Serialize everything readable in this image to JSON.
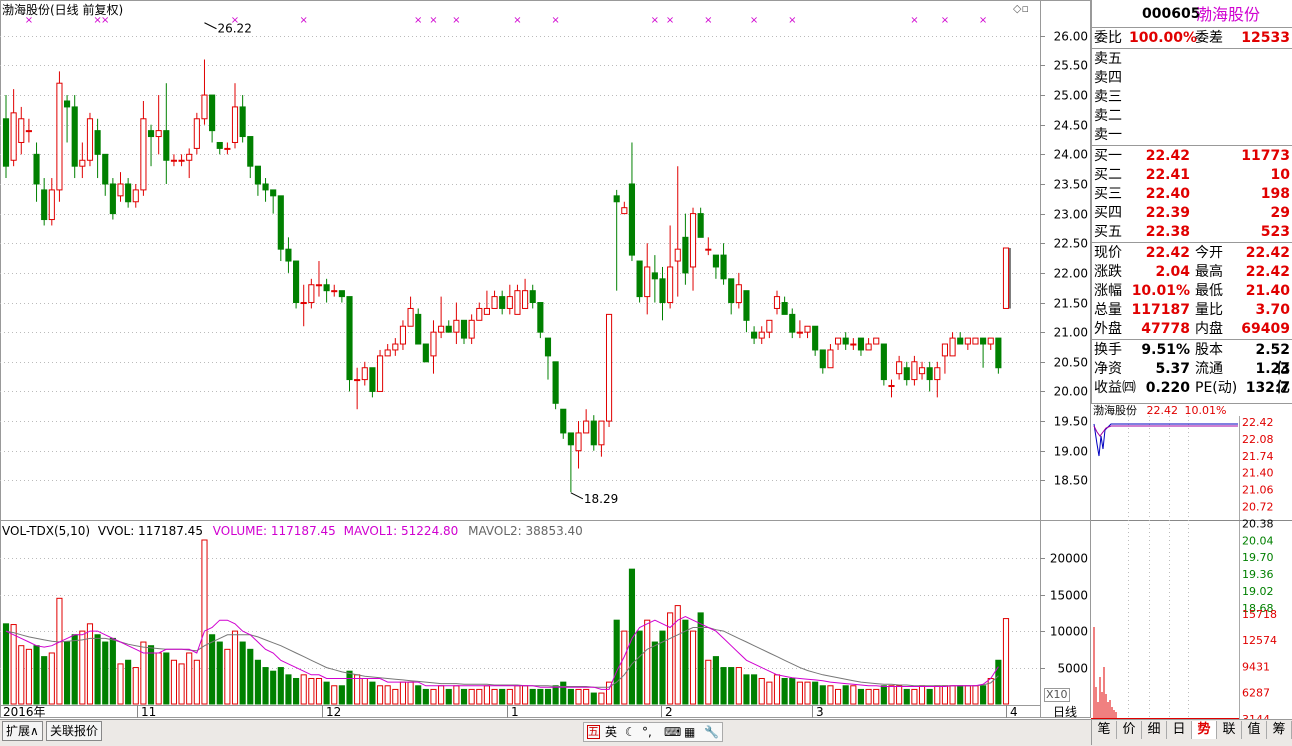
{
  "header": {
    "title": "渤海股份(日线 前复权)",
    "vol_label": "VOL-TDX(5,10)",
    "vvol": "VVOL: 117187.45",
    "volume": "VOLUME: 117187.45",
    "mavol1": "MAVOL1: 51224.80",
    "mavol2": "MAVOL2: 38853.40",
    "high_mark": "26.22",
    "low_mark": "18.29",
    "x_axis": [
      "2016年",
      "11",
      "12",
      "1",
      "2",
      "3",
      "4"
    ]
  },
  "quote": {
    "code": "000605",
    "name": "渤海股份",
    "weibi_label": "委比",
    "weibi": "100.00%",
    "weicha_label": "委差",
    "weicha": "12533",
    "sell": [
      {
        "label": "卖五"
      },
      {
        "label": "卖四"
      },
      {
        "label": "卖三"
      },
      {
        "label": "卖二"
      },
      {
        "label": "卖一"
      }
    ],
    "buy": [
      {
        "label": "买一",
        "price": "22.42",
        "vol": "11773"
      },
      {
        "label": "买二",
        "price": "22.41",
        "vol": "10"
      },
      {
        "label": "买三",
        "price": "22.40",
        "vol": "198"
      },
      {
        "label": "买四",
        "price": "22.39",
        "vol": "29"
      },
      {
        "label": "买五",
        "price": "22.38",
        "vol": "523"
      }
    ],
    "stats": [
      {
        "l1": "现价",
        "v1": "22.42",
        "l2": "今开",
        "v2": "22.42"
      },
      {
        "l1": "涨跌",
        "v1": "2.04",
        "l2": "最高",
        "v2": "22.42"
      },
      {
        "l1": "涨幅",
        "v1": "10.01%",
        "l2": "最低",
        "v2": "21.40"
      },
      {
        "l1": "总量",
        "v1": "117187",
        "l2": "量比",
        "v2": "3.70"
      },
      {
        "l1": "外盘",
        "v1": "47778",
        "l2": "内盘",
        "v2": "69409"
      }
    ],
    "fund": [
      {
        "l1": "换手",
        "v1": "9.51%",
        "l2": "股本",
        "v2": "2.52亿"
      },
      {
        "l1": "净资",
        "v1": "5.37",
        "l2": "流通",
        "v2": "1.23亿"
      },
      {
        "l1": "收益㈣",
        "v1": "0.220",
        "l2": "PE(动)",
        "v2": "132.7"
      }
    ]
  },
  "mini": {
    "name": "渤海股份",
    "price": "22.42",
    "pct": "10.01%",
    "price_ticks": [
      "22.42",
      "22.08",
      "21.74",
      "21.40",
      "21.06",
      "20.72",
      "20.38",
      "20.04",
      "19.70",
      "19.36",
      "19.02",
      "18.68"
    ],
    "vol_ticks": [
      "15718",
      "12574",
      "9431",
      "6287",
      "3144"
    ]
  },
  "bottom": {
    "tabs": [
      "扩展∧",
      "关联报价"
    ],
    "ime": [
      "五",
      "英"
    ],
    "period_label": "日线",
    "x10": "X10",
    "right_tabs": [
      "笔",
      "价",
      "细",
      "日",
      "势",
      "联",
      "值",
      "筹"
    ]
  },
  "colors": {
    "up": "#e00000",
    "down": "#008000",
    "ma1": "#d000d0",
    "ma2": "#777777",
    "mark": "#d000d0"
  },
  "chart_data": {
    "type": "candlestick",
    "title": "渤海股份(日线 前复权)",
    "ylim": [
      18.0,
      26.3
    ],
    "y_ticks": [
      18.5,
      19.0,
      19.5,
      20.0,
      20.5,
      21.0,
      21.5,
      22.0,
      22.5,
      23.0,
      23.5,
      24.0,
      24.5,
      25.0,
      25.5,
      26.0
    ],
    "vol_ticks": [
      5000,
      10000,
      15000,
      20000
    ],
    "vol_unit_label": "X10",
    "candles": [
      [
        24.6,
        23.8,
        25.0,
        23.6,
        11000
      ],
      [
        23.9,
        24.7,
        25.1,
        23.8,
        10900
      ],
      [
        24.2,
        24.6,
        24.8,
        24.0,
        8000
      ],
      [
        24.4,
        24.4,
        24.6,
        24.2,
        7500
      ],
      [
        24.0,
        23.5,
        24.2,
        23.2,
        8000
      ],
      [
        23.4,
        22.9,
        23.6,
        22.8,
        6500
      ],
      [
        22.9,
        23.4,
        23.6,
        22.8,
        7000
      ],
      [
        23.4,
        25.2,
        25.4,
        23.2,
        14500
      ],
      [
        24.9,
        24.8,
        25.0,
        24.2,
        8500
      ],
      [
        24.8,
        23.8,
        25.0,
        23.6,
        9500
      ],
      [
        23.8,
        23.9,
        24.2,
        23.6,
        10000
      ],
      [
        23.9,
        24.6,
        24.7,
        23.8,
        11000
      ],
      [
        24.4,
        24.0,
        24.6,
        23.6,
        9500
      ],
      [
        24.0,
        23.5,
        24.0,
        23.3,
        8500
      ],
      [
        23.5,
        23.0,
        23.6,
        22.9,
        9000
      ],
      [
        23.3,
        23.5,
        23.7,
        23.2,
        5500
      ],
      [
        23.5,
        23.2,
        23.6,
        23.1,
        6000
      ],
      [
        23.2,
        23.4,
        23.5,
        23.1,
        5000
      ],
      [
        23.4,
        24.6,
        24.9,
        23.3,
        8500
      ],
      [
        24.4,
        24.3,
        24.5,
        23.8,
        8000
      ],
      [
        24.3,
        24.4,
        25.0,
        24.0,
        7000
      ],
      [
        24.4,
        23.9,
        25.2,
        23.5,
        7000
      ],
      [
        23.9,
        23.9,
        24.0,
        23.8,
        6000
      ],
      [
        23.9,
        23.9,
        24.0,
        23.8,
        5500
      ],
      [
        23.9,
        24.0,
        24.1,
        23.6,
        7000
      ],
      [
        24.1,
        24.6,
        24.7,
        24.0,
        6000
      ],
      [
        24.6,
        25.0,
        25.6,
        24.5,
        22500
      ],
      [
        25.0,
        24.4,
        25.0,
        24.2,
        9500
      ],
      [
        24.2,
        24.1,
        24.2,
        24.0,
        8500
      ],
      [
        24.1,
        24.1,
        24.2,
        24.0,
        7500
      ],
      [
        24.2,
        24.8,
        25.2,
        24.1,
        10000
      ],
      [
        24.8,
        24.3,
        25.0,
        24.2,
        8500
      ],
      [
        24.3,
        23.8,
        24.3,
        23.6,
        7500
      ],
      [
        23.8,
        23.5,
        23.8,
        23.3,
        6000
      ],
      [
        23.5,
        23.4,
        23.6,
        23.2,
        5000
      ],
      [
        23.4,
        23.3,
        23.4,
        23.0,
        4500
      ],
      [
        23.3,
        22.4,
        23.3,
        22.2,
        5000
      ],
      [
        22.4,
        22.2,
        22.6,
        22.0,
        4000
      ],
      [
        22.2,
        21.5,
        22.2,
        21.4,
        3500
      ],
      [
        21.5,
        21.5,
        21.8,
        21.1,
        4000
      ],
      [
        21.5,
        21.8,
        21.9,
        21.4,
        3500
      ],
      [
        21.8,
        21.8,
        22.2,
        21.6,
        3500
      ],
      [
        21.8,
        21.7,
        21.9,
        21.5,
        3000
      ],
      [
        21.7,
        21.7,
        21.8,
        21.6,
        2500
      ],
      [
        21.7,
        21.6,
        21.7,
        21.5,
        2500
      ],
      [
        21.6,
        20.2,
        21.6,
        20.0,
        4500
      ],
      [
        20.2,
        20.2,
        20.4,
        19.7,
        4000
      ],
      [
        20.2,
        20.4,
        20.5,
        20.1,
        3500
      ],
      [
        20.4,
        20.0,
        20.4,
        19.9,
        3000
      ],
      [
        20.0,
        20.6,
        20.7,
        20.0,
        2500
      ],
      [
        20.6,
        20.7,
        20.8,
        20.6,
        2500
      ],
      [
        20.7,
        20.8,
        20.9,
        20.6,
        2000
      ],
      [
        20.8,
        21.1,
        21.2,
        20.7,
        3000
      ],
      [
        21.1,
        21.4,
        21.6,
        21.1,
        3000
      ],
      [
        21.3,
        20.8,
        21.4,
        20.8,
        2500
      ],
      [
        20.8,
        20.5,
        20.8,
        20.5,
        2000
      ],
      [
        20.6,
        21.0,
        21.2,
        20.3,
        2000
      ],
      [
        21.0,
        21.1,
        21.6,
        20.9,
        2500
      ],
      [
        21.1,
        21.0,
        21.2,
        21.0,
        2000
      ],
      [
        21.0,
        21.2,
        21.5,
        20.8,
        2500
      ],
      [
        21.2,
        20.9,
        21.2,
        20.8,
        2000
      ],
      [
        20.9,
        21.2,
        21.3,
        20.8,
        2000
      ],
      [
        21.2,
        21.4,
        21.5,
        21.2,
        2000
      ],
      [
        21.3,
        21.4,
        21.7,
        21.3,
        2500
      ],
      [
        21.4,
        21.6,
        21.7,
        21.4,
        2000
      ],
      [
        21.6,
        21.4,
        21.7,
        21.3,
        2000
      ],
      [
        21.4,
        21.6,
        21.8,
        21.3,
        2000
      ],
      [
        21.3,
        21.7,
        21.8,
        21.3,
        2500
      ],
      [
        21.4,
        21.7,
        21.9,
        21.4,
        2500
      ],
      [
        21.7,
        21.5,
        21.8,
        21.4,
        2000
      ],
      [
        21.5,
        21.0,
        21.5,
        20.9,
        2000
      ],
      [
        20.9,
        20.6,
        20.9,
        20.2,
        2000
      ],
      [
        20.5,
        19.8,
        20.5,
        19.7,
        2500
      ],
      [
        19.7,
        19.3,
        19.7,
        19.2,
        3000
      ],
      [
        19.3,
        19.1,
        19.3,
        18.3,
        2000
      ],
      [
        19.0,
        19.3,
        19.5,
        18.7,
        2000
      ],
      [
        19.3,
        19.5,
        19.7,
        19.3,
        2000
      ],
      [
        19.5,
        19.1,
        19.6,
        19.0,
        1500
      ],
      [
        19.1,
        19.5,
        19.5,
        18.9,
        1500
      ],
      [
        19.5,
        21.3,
        21.3,
        19.4,
        3000
      ],
      [
        23.3,
        23.2,
        23.4,
        21.7,
        11500
      ],
      [
        23.0,
        23.1,
        23.2,
        23.0,
        10000
      ],
      [
        23.5,
        22.3,
        24.2,
        22.2,
        18500
      ],
      [
        22.2,
        21.6,
        22.2,
        21.5,
        10000
      ],
      [
        21.6,
        22.1,
        22.5,
        21.3,
        11500
      ],
      [
        22.0,
        21.9,
        22.3,
        21.5,
        8500
      ],
      [
        21.9,
        21.5,
        22.1,
        21.2,
        10000
      ],
      [
        21.5,
        22.1,
        22.8,
        21.4,
        12500
      ],
      [
        22.2,
        22.4,
        23.8,
        21.6,
        13500
      ],
      [
        22.6,
        22.0,
        23.0,
        21.8,
        11500
      ],
      [
        22.1,
        23.0,
        23.1,
        21.7,
        10000
      ],
      [
        23.0,
        22.6,
        23.1,
        22.6,
        12500
      ],
      [
        22.4,
        22.4,
        22.6,
        22.3,
        6000
      ],
      [
        22.3,
        22.1,
        22.3,
        21.9,
        6500
      ],
      [
        22.3,
        21.9,
        22.5,
        21.8,
        5000
      ],
      [
        21.9,
        21.5,
        21.9,
        21.3,
        5000
      ],
      [
        21.5,
        21.8,
        22.0,
        21.4,
        5000
      ],
      [
        21.7,
        21.2,
        21.7,
        21.0,
        4000
      ],
      [
        21.0,
        20.9,
        21.1,
        20.8,
        4000
      ],
      [
        20.9,
        21.0,
        21.1,
        20.8,
        3500
      ],
      [
        21.0,
        21.2,
        21.2,
        20.9,
        3000
      ],
      [
        21.4,
        21.6,
        21.7,
        21.3,
        4000
      ],
      [
        21.5,
        21.3,
        21.6,
        21.3,
        3500
      ],
      [
        21.3,
        21.0,
        21.4,
        20.9,
        3500
      ],
      [
        21.0,
        21.0,
        21.2,
        20.9,
        3000
      ],
      [
        21.0,
        21.1,
        21.1,
        20.9,
        3000
      ],
      [
        21.1,
        20.7,
        21.1,
        20.6,
        3000
      ],
      [
        20.7,
        20.4,
        20.7,
        20.3,
        2500
      ],
      [
        20.4,
        20.7,
        20.8,
        20.4,
        2500
      ],
      [
        20.8,
        20.9,
        20.9,
        20.7,
        2000
      ],
      [
        20.9,
        20.8,
        21.0,
        20.7,
        2500
      ],
      [
        20.8,
        20.8,
        20.9,
        20.7,
        2500
      ],
      [
        20.9,
        20.7,
        20.9,
        20.6,
        2000
      ],
      [
        20.7,
        20.8,
        20.9,
        20.7,
        2000
      ],
      [
        20.8,
        20.9,
        20.9,
        20.8,
        2000
      ],
      [
        20.8,
        20.2,
        20.8,
        20.1,
        2500
      ],
      [
        20.1,
        20.1,
        20.2,
        19.9,
        2500
      ],
      [
        20.3,
        20.5,
        20.6,
        20.2,
        2500
      ],
      [
        20.4,
        20.2,
        20.5,
        20.1,
        2000
      ],
      [
        20.2,
        20.5,
        20.6,
        20.1,
        2000
      ],
      [
        20.3,
        20.4,
        20.5,
        20.2,
        2500
      ],
      [
        20.4,
        20.2,
        20.5,
        20.0,
        2000
      ],
      [
        20.2,
        20.4,
        20.5,
        19.9,
        2500
      ],
      [
        20.6,
        20.8,
        20.8,
        20.3,
        2500
      ],
      [
        20.6,
        20.9,
        21.0,
        20.6,
        2500
      ],
      [
        20.9,
        20.8,
        21.0,
        20.8,
        2500
      ],
      [
        20.8,
        20.9,
        20.9,
        20.7,
        2500
      ],
      [
        20.8,
        20.9,
        20.9,
        20.8,
        2500
      ],
      [
        20.9,
        20.8,
        20.9,
        20.4,
        2500
      ],
      [
        20.8,
        20.9,
        20.9,
        20.7,
        3500
      ],
      [
        20.9,
        20.4,
        20.9,
        20.3,
        6000
      ],
      [
        21.4,
        22.42,
        22.42,
        21.4,
        11718.7
      ]
    ],
    "mavol1": [
      10000,
      9500,
      9000,
      8500,
      8000,
      7800,
      8000,
      8500,
      9000,
      9500,
      9500,
      10000,
      10000,
      9500,
      9000,
      8500,
      8000,
      7500,
      7000,
      7000,
      7000,
      7500,
      7500,
      7500,
      7500,
      7000,
      10000,
      10500,
      11500,
      11500,
      11000,
      10000,
      9500,
      8500,
      7500,
      7000,
      6000,
      5500,
      5000,
      4500,
      4000,
      4000,
      3500,
      3500,
      3500,
      3500,
      3500,
      3500,
      3500,
      3500,
      3000,
      3000,
      3000,
      3000,
      3000,
      2500,
      2500,
      2500,
      2500,
      2500,
      2500,
      2500,
      2500,
      2500,
      2500,
      2500,
      2500,
      2500,
      2500,
      2500,
      2300,
      2300,
      2300,
      2300,
      2300,
      2300,
      2300,
      2300,
      2000,
      2000,
      4500,
      6500,
      9000,
      10500,
      11000,
      11500,
      11000,
      10500,
      11500,
      12000,
      11500,
      11000,
      10500,
      10000,
      9000,
      8000,
      7000,
      6000,
      5500,
      5000,
      4500,
      4000,
      3800,
      3600,
      3500,
      3400,
      3300,
      3200,
      3000,
      2900,
      2800,
      2700,
      2600,
      2500,
      2500,
      2400,
      2400,
      2400,
      2400,
      2400,
      2400,
      2400,
      2400,
      2400,
      2500,
      2500,
      2500,
      2500,
      2700,
      3500,
      5122.48
    ],
    "mavol2": [
      10000,
      9800,
      9500,
      9200,
      9000,
      8800,
      8600,
      8500,
      8600,
      8700,
      8800,
      9000,
      9000,
      9000,
      8800,
      8500,
      8200,
      8000,
      7800,
      7700,
      7600,
      7500,
      7500,
      7500,
      7400,
      7300,
      8000,
      8500,
      9000,
      9500,
      9500,
      9500,
      9500,
      9200,
      8800,
      8400,
      8000,
      7500,
      7000,
      6500,
      6000,
      5500,
      5000,
      4700,
      4400,
      4200,
      4000,
      3800,
      3700,
      3600,
      3500,
      3400,
      3300,
      3200,
      3100,
      3000,
      2900,
      2800,
      2800,
      2800,
      2700,
      2700,
      2700,
      2700,
      2600,
      2600,
      2600,
      2600,
      2500,
      2500,
      2500,
      2500,
      2400,
      2400,
      2400,
      2400,
      2400,
      2300,
      2300,
      2300,
      3000,
      4000,
      5500,
      6500,
      7500,
      8000,
      8500,
      9000,
      9500,
      10000,
      10500,
      10500,
      10500,
      10200,
      10000,
      9500,
      9000,
      8500,
      8000,
      7500,
      7000,
      6500,
      6000,
      5500,
      5000,
      4600,
      4300,
      4000,
      3800,
      3600,
      3400,
      3200,
      3000,
      2900,
      2800,
      2700,
      2700,
      2600,
      2600,
      2500,
      2500,
      2500,
      2500,
      2500,
      2500,
      2500,
      2500,
      2500,
      2600,
      2900,
      3885.34
    ]
  }
}
